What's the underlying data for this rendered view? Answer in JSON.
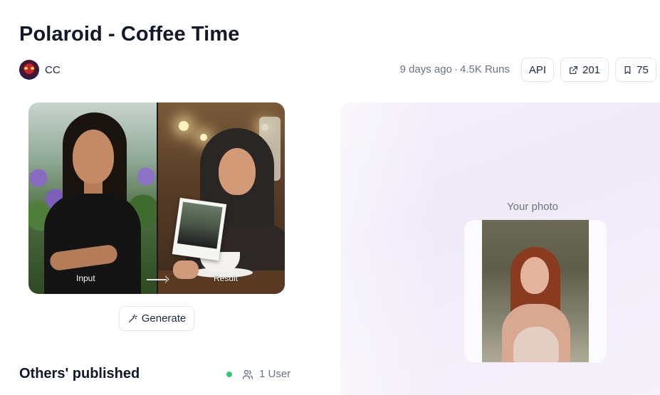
{
  "page": {
    "title": "Polaroid - Coffee Time"
  },
  "author": {
    "avatar_icon": "owl-avatar-icon",
    "name": "CC"
  },
  "stats": {
    "age": "9 days ago",
    "separator": "·",
    "runs": "4.5K Runs"
  },
  "actions": {
    "api_label": "API",
    "share_count": "201",
    "share_icon": "share-icon",
    "save_count": "75",
    "save_icon": "bookmark-icon"
  },
  "comparison": {
    "input_label": "Input",
    "result_label": "Result",
    "arrow_icon": "arrow-right-icon"
  },
  "generate": {
    "label": "Generate",
    "icon": "magic-wand-icon"
  },
  "published": {
    "title": "Others' published",
    "status_color": "#34c77b",
    "users_icon": "users-icon",
    "users_label": "1 User"
  },
  "upload_panel": {
    "label": "Your photo"
  }
}
